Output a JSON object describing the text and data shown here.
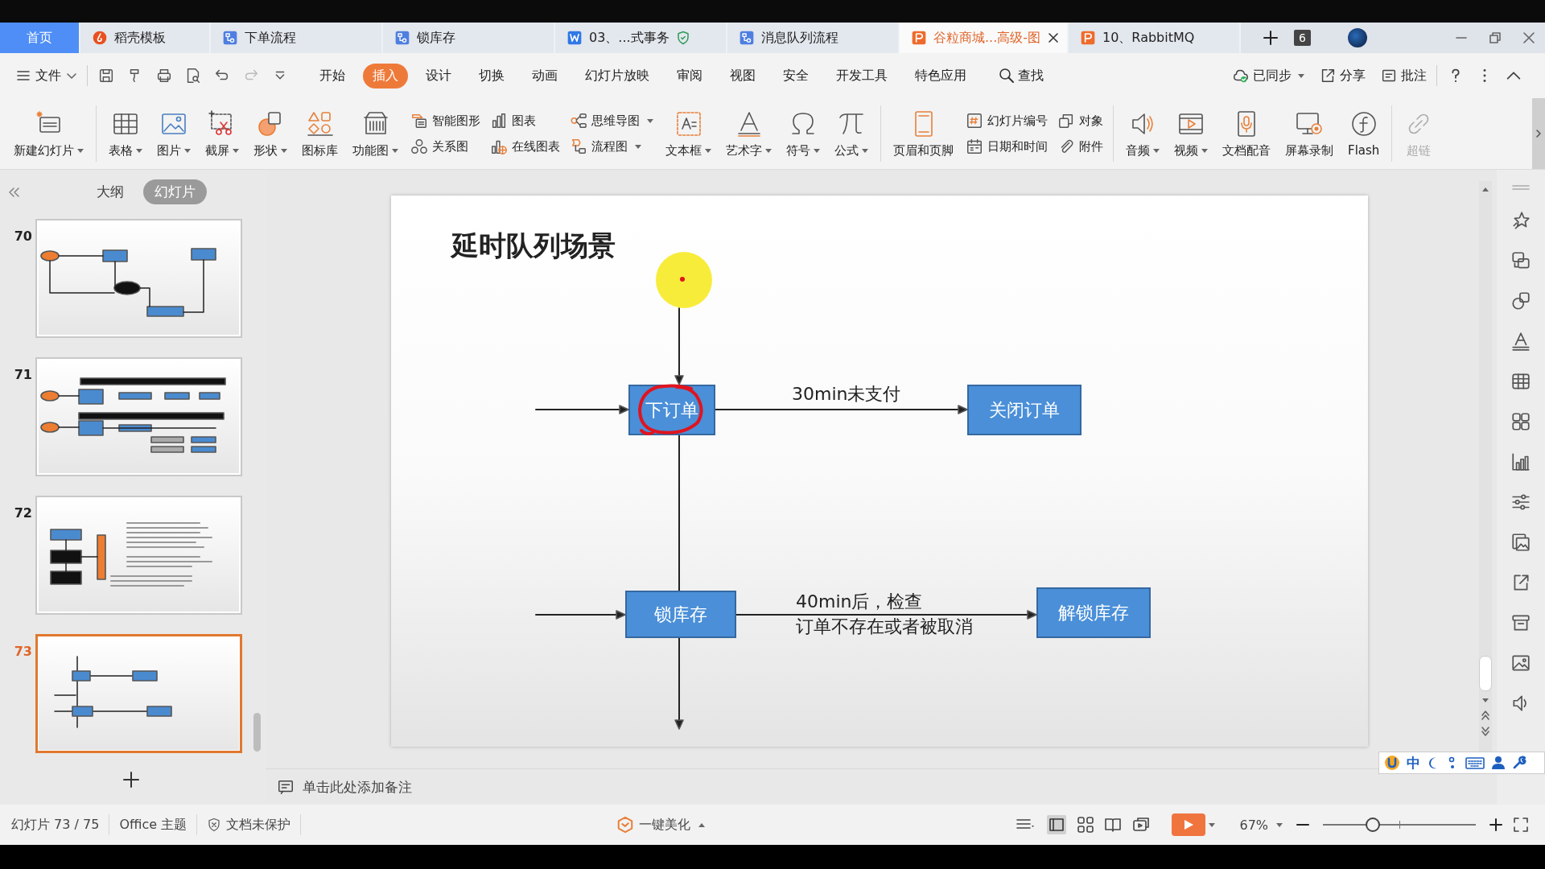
{
  "tabs": [
    {
      "label": "首页",
      "kind": "home",
      "selected": false,
      "closable": false,
      "protected": false
    },
    {
      "label": "稻壳模板",
      "kind": "docer",
      "selected": false,
      "closable": false,
      "protected": false
    },
    {
      "label": "下单流程",
      "kind": "flow",
      "selected": false,
      "closable": false,
      "protected": false
    },
    {
      "label": "锁库存",
      "kind": "flow",
      "selected": false,
      "closable": false,
      "protected": false
    },
    {
      "label": "03、...式事务",
      "kind": "word",
      "selected": false,
      "closable": false,
      "protected": true
    },
    {
      "label": "消息队列流程",
      "kind": "flow",
      "selected": false,
      "closable": false,
      "protected": false
    },
    {
      "label": "谷粒商城...高级-图",
      "kind": "ppt",
      "selected": true,
      "closable": true,
      "protected": false
    },
    {
      "label": "10、RabbitMQ",
      "kind": "ppt",
      "selected": false,
      "closable": false,
      "protected": false
    }
  ],
  "window_count": "6",
  "file_menu": "文件",
  "menu_tabs": [
    {
      "label": "开始",
      "selected": false
    },
    {
      "label": "插入",
      "selected": true
    },
    {
      "label": "设计",
      "selected": false
    },
    {
      "label": "切换",
      "selected": false
    },
    {
      "label": "动画",
      "selected": false
    },
    {
      "label": "幻灯片放映",
      "selected": false
    },
    {
      "label": "审阅",
      "selected": false
    },
    {
      "label": "视图",
      "selected": false
    },
    {
      "label": "安全",
      "selected": false
    },
    {
      "label": "开发工具",
      "selected": false
    },
    {
      "label": "特色应用",
      "selected": false
    }
  ],
  "search": "查找",
  "menu_actions": [
    {
      "label": "已同步",
      "dropdown": true
    },
    {
      "label": "分享",
      "dropdown": false
    },
    {
      "label": "批注",
      "dropdown": false
    }
  ],
  "ribbon": [
    {
      "kind": "big",
      "label": "新建幻灯片",
      "dropdown": true,
      "disabled": false
    },
    {
      "kind": "separator"
    },
    {
      "kind": "big",
      "label": "表格",
      "dropdown": true,
      "disabled": false
    },
    {
      "kind": "big",
      "label": "图片",
      "dropdown": true,
      "disabled": false
    },
    {
      "kind": "big",
      "label": "截屏",
      "dropdown": true,
      "disabled": false
    },
    {
      "kind": "big",
      "label": "形状",
      "dropdown": true,
      "disabled": false
    },
    {
      "kind": "big",
      "label": "图标库",
      "dropdown": false,
      "disabled": false
    },
    {
      "kind": "big",
      "label": "功能图",
      "dropdown": true,
      "disabled": false
    },
    {
      "kind": "stack",
      "items": [
        {
          "label": "智能图形",
          "dropdown": false
        },
        {
          "label": "关系图",
          "dropdown": false
        }
      ]
    },
    {
      "kind": "stack",
      "items": [
        {
          "label": "图表",
          "dropdown": false
        },
        {
          "label": "在线图表",
          "dropdown": false
        }
      ]
    },
    {
      "kind": "stack",
      "items": [
        {
          "label": "思维导图",
          "dropdown": true
        },
        {
          "label": "流程图",
          "dropdown": true
        }
      ]
    },
    {
      "kind": "big",
      "label": "文本框",
      "dropdown": true,
      "disabled": false
    },
    {
      "kind": "big",
      "label": "艺术字",
      "dropdown": true,
      "disabled": false
    },
    {
      "kind": "big",
      "label": "符号",
      "dropdown": true,
      "disabled": false
    },
    {
      "kind": "big",
      "label": "公式",
      "dropdown": true,
      "disabled": false
    },
    {
      "kind": "separator"
    },
    {
      "kind": "big",
      "label": "页眉和页脚",
      "dropdown": false,
      "disabled": false
    },
    {
      "kind": "stack",
      "items": [
        {
          "label": "幻灯片编号",
          "dropdown": false
        },
        {
          "label": "日期和时间",
          "dropdown": false
        }
      ]
    },
    {
      "kind": "stack",
      "items": [
        {
          "label": "对象",
          "dropdown": false
        },
        {
          "label": "附件",
          "dropdown": false
        }
      ]
    },
    {
      "kind": "separator"
    },
    {
      "kind": "big",
      "label": "音频",
      "dropdown": true,
      "disabled": false
    },
    {
      "kind": "big",
      "label": "视频",
      "dropdown": true,
      "disabled": false
    },
    {
      "kind": "big",
      "label": "文档配音",
      "dropdown": false,
      "disabled": false
    },
    {
      "kind": "big",
      "label": "屏幕录制",
      "dropdown": false,
      "disabled": false
    },
    {
      "kind": "big",
      "label": "Flash",
      "dropdown": false,
      "disabled": false
    },
    {
      "kind": "separator"
    },
    {
      "kind": "big",
      "label": "超链",
      "dropdown": false,
      "disabled": true
    }
  ],
  "panel_views": [
    {
      "label": "大纲",
      "selected": false
    },
    {
      "label": "幻灯片",
      "selected": true
    }
  ],
  "slides": [
    {
      "number": "70",
      "selected": false
    },
    {
      "number": "71",
      "selected": false
    },
    {
      "number": "72",
      "selected": false
    },
    {
      "number": "73",
      "selected": true
    }
  ],
  "slide": {
    "title": "延时队列场景",
    "pointer_highlight": true,
    "nodes": [
      {
        "label": "下订单",
        "circled": true
      },
      {
        "label": "关闭订单",
        "circled": false
      },
      {
        "label": "锁库存",
        "circled": false
      },
      {
        "label": "解锁库存",
        "circled": false
      }
    ],
    "edge_labels": [
      {
        "lines": [
          "30min未支付"
        ]
      },
      {
        "lines": [
          "40min后，检查",
          "订单不存在或者被取消"
        ]
      }
    ]
  },
  "notes_placeholder": "单击此处添加备注",
  "ime_bar": {
    "label": "中"
  },
  "status_bar": {
    "slide_count": "幻灯片 73 / 75",
    "theme": "Office 主题",
    "protection": "文档未保护",
    "beautify": "一键美化",
    "zoom": "67%",
    "zoom_slider": {
      "level": 0.32
    }
  }
}
